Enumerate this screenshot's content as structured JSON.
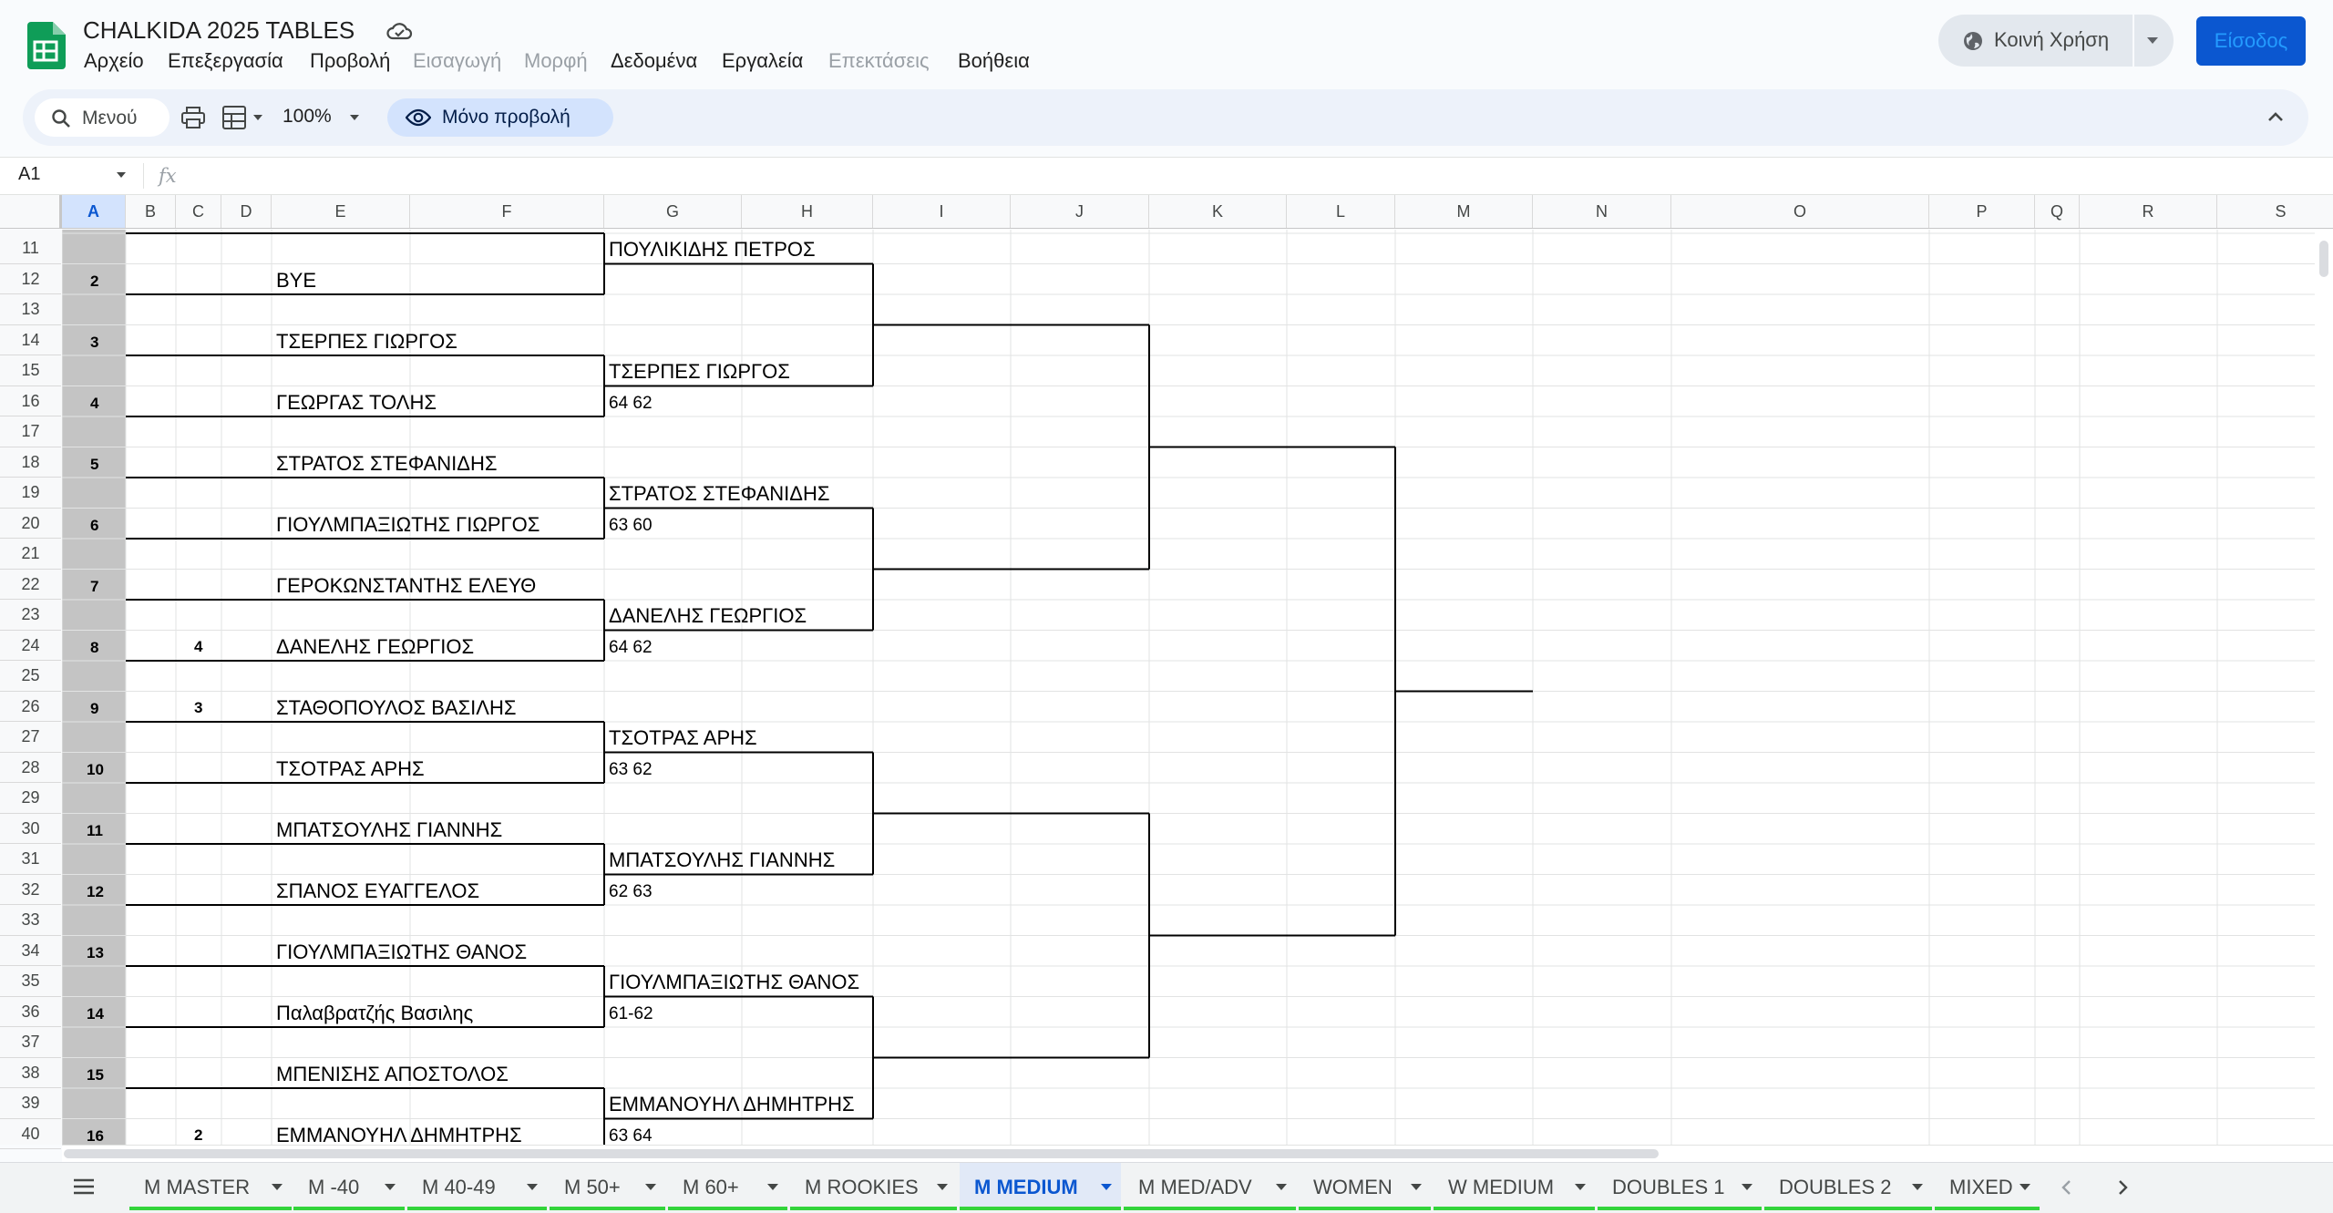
{
  "app": {
    "title": "CHALKIDA 2025 TABLES",
    "menu": [
      "Αρχείο",
      "Επεξεργασία",
      "Προβολή",
      "Εισαγωγή",
      "Μορφή",
      "Δεδομένα",
      "Εργαλεία",
      "Επεκτάσεις",
      "Βοήθεια"
    ],
    "share_label": "Κοινή Χρήση",
    "signin_label": "Είσοδος"
  },
  "toolbar": {
    "search_label": "Μενού",
    "zoom": "100%",
    "view_only_label": "Μόνο προβολή"
  },
  "formula": {
    "cell_ref": "A1",
    "fx": "fx"
  },
  "columns": [
    "A",
    "B",
    "C",
    "D",
    "E",
    "F",
    "G",
    "H",
    "I",
    "J",
    "K",
    "L",
    "M",
    "N",
    "O",
    "P",
    "Q",
    "R",
    "S"
  ],
  "rows": [
    "11",
    "12",
    "13",
    "14",
    "15",
    "16",
    "17",
    "18",
    "19",
    "20",
    "21",
    "22",
    "23",
    "24",
    "25",
    "26",
    "27",
    "28",
    "29",
    "30",
    "31",
    "32",
    "33",
    "34",
    "35",
    "36",
    "37",
    "38",
    "39",
    "40"
  ],
  "draw_numbers": [
    {
      "row": "12",
      "n": "2"
    },
    {
      "row": "14",
      "n": "3"
    },
    {
      "row": "16",
      "n": "4"
    },
    {
      "row": "18",
      "n": "5"
    },
    {
      "row": "20",
      "n": "6"
    },
    {
      "row": "22",
      "n": "7"
    },
    {
      "row": "24",
      "n": "8"
    },
    {
      "row": "26",
      "n": "9"
    },
    {
      "row": "28",
      "n": "10"
    },
    {
      "row": "30",
      "n": "11"
    },
    {
      "row": "32",
      "n": "12"
    },
    {
      "row": "34",
      "n": "13"
    },
    {
      "row": "36",
      "n": "14"
    },
    {
      "row": "38",
      "n": "15"
    },
    {
      "row": "40",
      "n": "16"
    }
  ],
  "seeds": [
    {
      "row": "24",
      "n": "4"
    },
    {
      "row": "26",
      "n": "3"
    },
    {
      "row": "40",
      "n": "2"
    }
  ],
  "round1": [
    {
      "row": "12",
      "name": "BYE"
    },
    {
      "row": "14",
      "name": "ΤΣΕΡΠΕΣ ΓΙΩΡΓΟΣ"
    },
    {
      "row": "16",
      "name": "ΓΕΩΡΓΑΣ ΤΟΛΗΣ"
    },
    {
      "row": "18",
      "name": "ΣΤΡΑΤΟΣ ΣΤΕΦΑΝΙΔΗΣ"
    },
    {
      "row": "20",
      "name": "ΓΙΟΥΛΜΠΑΞΙΩΤΗΣ ΓΙΩΡΓΟΣ"
    },
    {
      "row": "22",
      "name": "ΓΕΡΟΚΩΝΣΤΑΝΤΗΣ ΕΛΕΥΘ"
    },
    {
      "row": "24",
      "name": "ΔΑΝΕΛΗΣ ΓΕΩΡΓΙΟΣ"
    },
    {
      "row": "26",
      "name": "ΣΤΑΘΟΠΟΥΛΟΣ ΒΑΣΙΛΗΣ"
    },
    {
      "row": "28",
      "name": "ΤΣΟΤΡΑΣ ΑΡΗΣ"
    },
    {
      "row": "30",
      "name": "ΜΠΑΤΣΟΥΛΗΣ ΓΙΑΝΝΗΣ"
    },
    {
      "row": "32",
      "name": "ΣΠΑΝΟΣ ΕΥΑΓΓΕΛΟΣ"
    },
    {
      "row": "34",
      "name": "ΓΙΟΥΛΜΠΑΞΙΩΤΗΣ ΘΑΝΟΣ"
    },
    {
      "row": "36",
      "name": "Παλαβρατζής Βασιλης"
    },
    {
      "row": "38",
      "name": "ΜΠΕΝΙΣΗΣ ΑΠΟΣΤΟΛΟΣ"
    },
    {
      "row": "40",
      "name": "ΕΜΜΑΝΟΥΗΛ ΔΗΜΗΤΡΗΣ"
    }
  ],
  "round2": [
    {
      "row": "11",
      "name": "ΠΟΥΛΙΚΙΔΗΣ ΠΕΤΡΟΣ",
      "score": ""
    },
    {
      "row": "15",
      "name": "ΤΣΕΡΠΕΣ ΓΙΩΡΓΟΣ",
      "score": "64 62"
    },
    {
      "row": "19",
      "name": "ΣΤΡΑΤΟΣ ΣΤΕΦΑΝΙΔΗΣ",
      "score": "63 60"
    },
    {
      "row": "23",
      "name": "ΔΑΝΕΛΗΣ ΓΕΩΡΓΙΟΣ",
      "score": "64 62"
    },
    {
      "row": "27",
      "name": "ΤΣΟΤΡΑΣ ΑΡΗΣ",
      "score": "63 62"
    },
    {
      "row": "31",
      "name": "ΜΠΑΤΣΟΥΛΗΣ ΓΙΑΝΝΗΣ",
      "score": "62 63"
    },
    {
      "row": "35",
      "name": "ΓΙΟΥΛΜΠΑΞΙΩΤΗΣ ΘΑΝΟΣ",
      "score": "61-62"
    },
    {
      "row": "39",
      "name": "ΕΜΜΑΝΟΥΗΛ ΔΗΜΗΤΡΗΣ",
      "score": "63 64"
    }
  ],
  "sheets": [
    {
      "label": "M MASTER",
      "active": false
    },
    {
      "label": "M -40",
      "active": false
    },
    {
      "label": "M 40-49",
      "active": false
    },
    {
      "label": "M 50+",
      "active": false
    },
    {
      "label": "M 60+",
      "active": false
    },
    {
      "label": "M ROOKIES",
      "active": false
    },
    {
      "label": "M MEDIUM",
      "active": true
    },
    {
      "label": "M MED/ADV",
      "active": false
    },
    {
      "label": "WOMEN",
      "active": false
    },
    {
      "label": "W MEDIUM",
      "active": false
    },
    {
      "label": "DOUBLES 1",
      "active": false
    },
    {
      "label": "DOUBLES 2",
      "active": false
    },
    {
      "label": "MIXED",
      "active": false
    }
  ],
  "colors": {
    "accent": "#0b57d0",
    "tab_underline": "#34d43b",
    "selected_header": "#d3e3fd"
  }
}
